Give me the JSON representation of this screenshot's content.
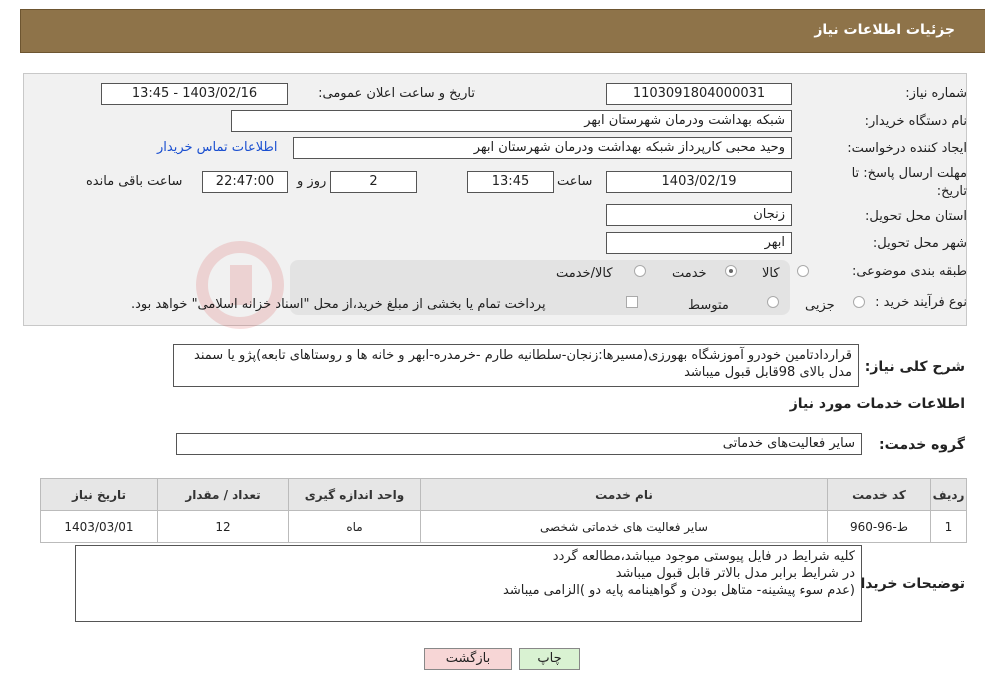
{
  "header": {
    "title": "جزئیات اطلاعات نیاز"
  },
  "form": {
    "need_number_label": "شماره نیاز:",
    "need_number": "1103091804000031",
    "announce_label": "تاریخ و ساعت اعلان عمومی:",
    "announce_value": "1403/02/16 - 13:45",
    "buyer_org_label": "نام دستگاه خریدار:",
    "buyer_org": "شبکه بهداشت ودرمان شهرستان ابهر",
    "creator_label": "ایجاد کننده درخواست:",
    "creator": "وحید محبی کارپرداز شبکه بهداشت ودرمان شهرستان ابهر",
    "contact_link": "اطلاعات تماس خریدار",
    "deadline_label_1": "مهلت ارسال پاسخ: تا",
    "deadline_label_2": "تاریخ:",
    "deadline_date": "1403/02/19",
    "time_label": "ساعت",
    "deadline_time": "13:45",
    "days": "2",
    "days_label": "روز و",
    "remaining_time": "22:47:00",
    "remaining_label": "ساعت باقی مانده",
    "province_label": "استان محل تحویل:",
    "province": "زنجان",
    "city_label": "شهر محل تحویل:",
    "city": "ابهر",
    "category_label": "طبقه بندی موضوعی:",
    "category_options": [
      "کالا",
      "خدمت",
      "کالا/خدمت"
    ],
    "category_selected": "خدمت",
    "process_label": "نوع فرآیند خرید :",
    "process_options": [
      "جزیی",
      "متوسط"
    ],
    "payment_note": "پرداخت تمام یا بخشی از مبلغ خرید،از محل \"اسناد خزانه اسلامی\" خواهد بود."
  },
  "description": {
    "label": "شرح کلی نیاز:",
    "text": "قراردادتامین خودرو آموزشگاه بهورزی(مسیرها:زنجان-سلطانیه طارم -خرمدره-ابهر و خانه ها و روستاهای تابعه)پژو یا سمند مدل بالای 98قابل قبول میباشد"
  },
  "services_title": "اطلاعات خدمات مورد نیاز",
  "service_group": {
    "label": "گروه خدمت:",
    "value": "سایر فعالیت‌های خدماتی"
  },
  "table": {
    "headers": [
      "ردیف",
      "کد خدمت",
      "نام خدمت",
      "واحد اندازه گیری",
      "تعداد / مقدار",
      "تاریخ نیاز"
    ],
    "rows": [
      [
        "1",
        "ط-96-960",
        "سایر فعالیت های خدماتی شخصی",
        "ماه",
        "12",
        "1403/03/01"
      ]
    ]
  },
  "buyer_notes": {
    "label": "توضیحات خریدار:",
    "lines": [
      "کلیه شرایط در فایل پیوستی موجود میباشد،مطالعه گردد",
      "در شرایط برابر مدل بالاتر قابل قبول میباشد",
      "(عدم سوء پیشینه- متاهل بودن و گواهینامه پایه دو )الزامی میباشد"
    ]
  },
  "buttons": {
    "print": "چاپ",
    "back": "بازگشت"
  },
  "colors": {
    "header_bg": "#8e7349",
    "link": "#1a4fd0",
    "back_btn": "#f7d6d6",
    "print_btn": "#d9f2d2"
  }
}
